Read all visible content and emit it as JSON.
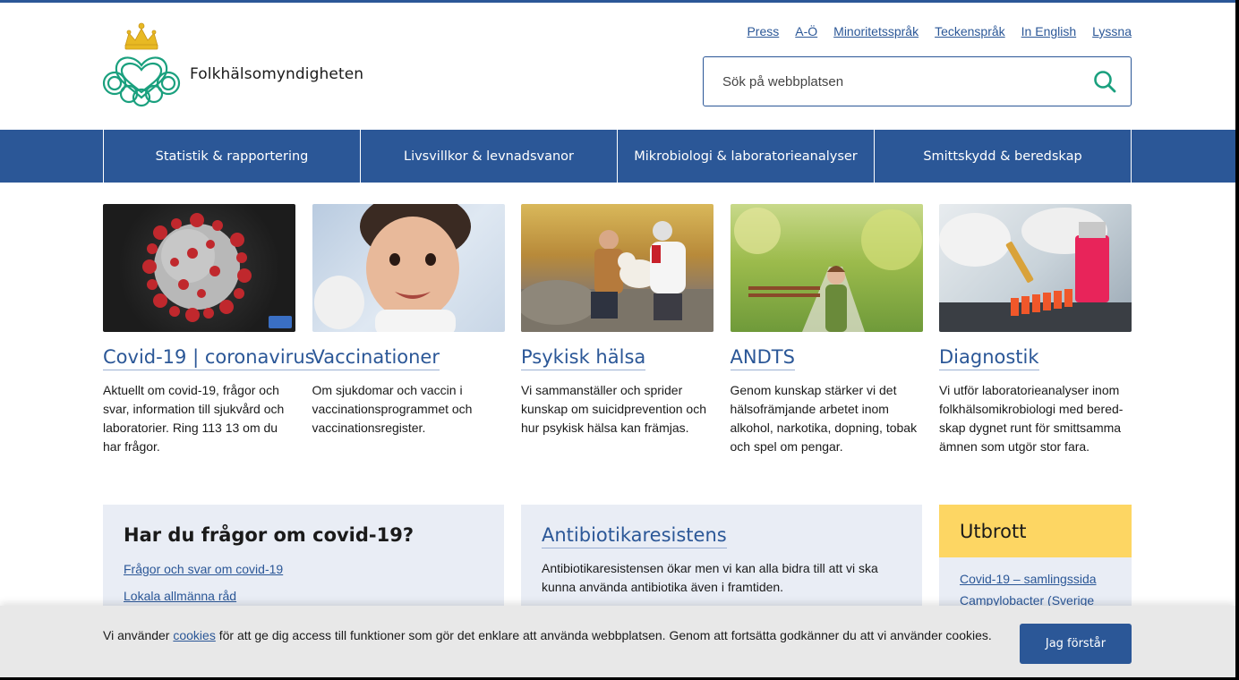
{
  "header": {
    "org_name": "Folkhälsomyndigheten",
    "top_links": [
      "Press",
      "A-Ö",
      "Minoritetsspråk",
      "Teckenspråk",
      "In English",
      "Lyssna"
    ],
    "search_placeholder": "Sök på webbplatsen"
  },
  "nav": {
    "items": [
      "Statistik & rapportering",
      "Livsvillkor & levnadsvanor",
      "Mikrobiologi & laboratorieanalyser",
      "Smittskydd & beredskap"
    ]
  },
  "cards": [
    {
      "title": "Covid-19 | coronavirus",
      "text": "Aktuellt om covid-19, frågor och svar, information till sjukvård och laboratorier. Ring 113 13 om du har frågor."
    },
    {
      "title": "Vaccinationer",
      "text": "Om sjukdomar och vaccin i vaccinationsprogrammet och vaccinationsregister."
    },
    {
      "title": "Psykisk hälsa",
      "text": "Vi sammanställer och sprider kunskap om suicidprevention och hur psykisk hälsa kan främjas."
    },
    {
      "title": "ANDTS",
      "text": "Genom kunskap stärker vi det hälsofrämjande arbetet inom alkohol, narkotika, dopning, tobak och spel om pengar."
    },
    {
      "title": "Diagnostik",
      "text": "Vi utför laboratorieanalyser inom folkhälsomikrobiologi med bered-skap dygnet runt för smittsamma ämnen som utgör stor fara."
    }
  ],
  "covid_box": {
    "heading": "Har du frågor om covid-19?",
    "links": [
      "Frågor och svar om covid-19",
      "Lokala allmänna råd"
    ]
  },
  "antibiotic_box": {
    "heading": "Antibiotikaresistens",
    "text": "Antibiotikaresistensen ökar men vi kan alla bidra till att vi ska kunna använda antibiotika även i framtiden."
  },
  "outbreak_box": {
    "heading": "Utbrott",
    "links": [
      "Covid-19 – samlingssida",
      "Campylobacter (Sverige"
    ]
  },
  "cookie": {
    "text_before": "Vi använder ",
    "link": "cookies",
    "text_after": " för att ge dig access till funktioner som gör det enklare att använda webbplatsen. Genom att fortsätta godkänner du att vi använder cookies.",
    "button": "Jag förstår"
  },
  "colors": {
    "primary": "#2b5797",
    "outbreak_yellow": "#fdd663",
    "box_bg": "#e9edf5",
    "logo_teal": "#1aa07e",
    "crown_gold": "#e8b923"
  }
}
